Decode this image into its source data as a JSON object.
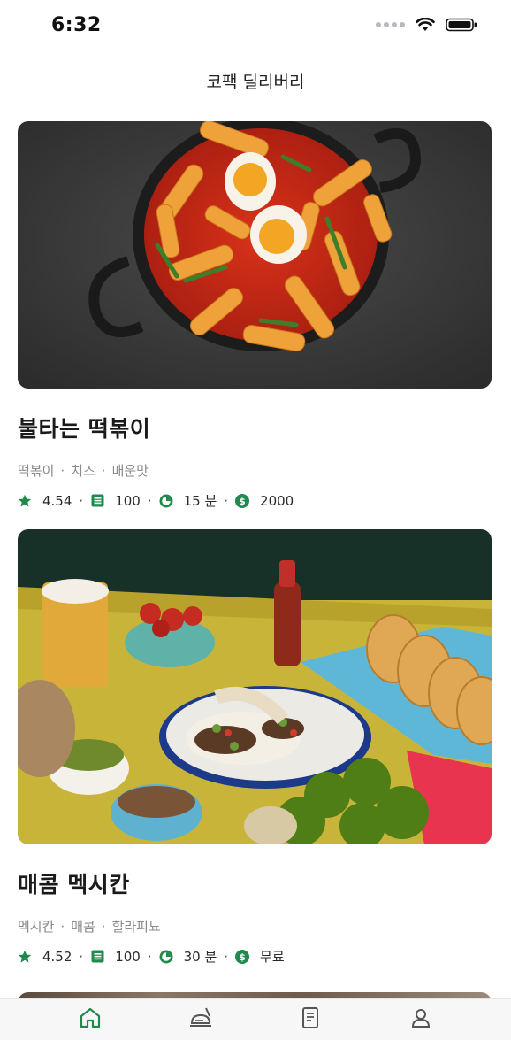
{
  "status_bar": {
    "time": "6:32"
  },
  "header": {
    "title": "코팩 딜리버리"
  },
  "restaurants": [
    {
      "name": "불타는 떡볶이",
      "tags": [
        "떡볶이",
        "치즈",
        "매운맛"
      ],
      "rating": "4.54",
      "reviews": "100",
      "time": "15 분",
      "fee": "2000"
    },
    {
      "name": "매콤 멕시칸",
      "tags": [
        "멕시칸",
        "매콤",
        "할라피뇨"
      ],
      "rating": "4.52",
      "reviews": "100",
      "time": "30 분",
      "fee": "무료"
    }
  ],
  "tabs": [
    {
      "icon": "home-icon",
      "active": true
    },
    {
      "icon": "food-tray-icon",
      "active": false
    },
    {
      "icon": "receipt-icon",
      "active": false
    },
    {
      "icon": "profile-icon",
      "active": false
    }
  ],
  "colors": {
    "accent": "#1f8a4c",
    "text": "#1a1a1a",
    "muted": "#8a8a8f"
  }
}
